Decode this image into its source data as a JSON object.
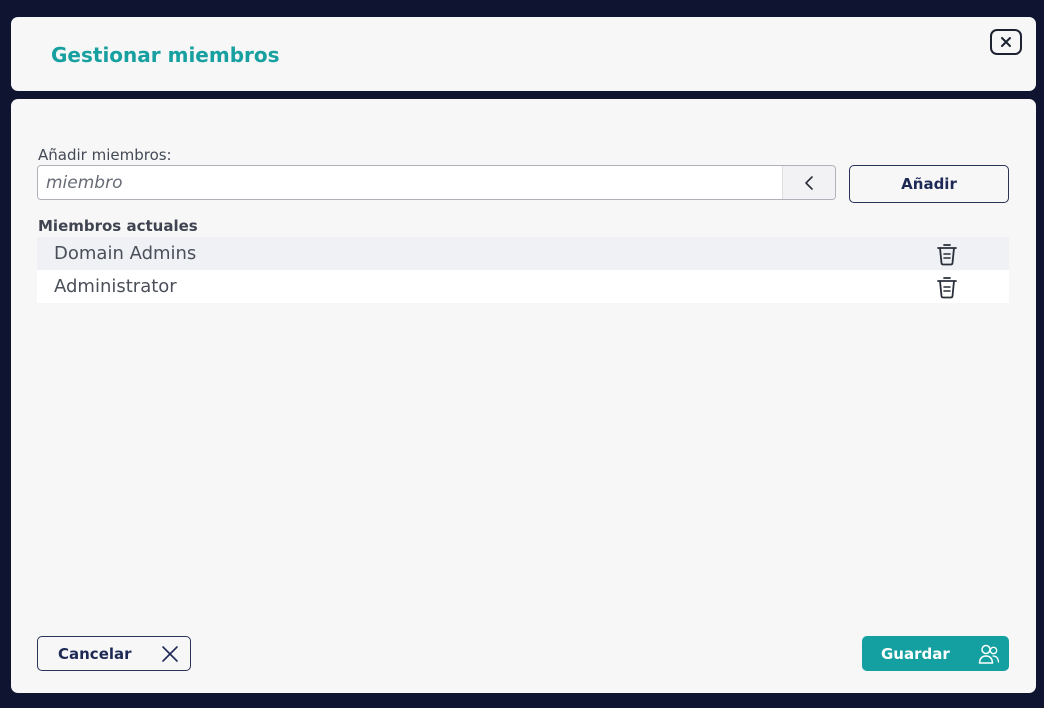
{
  "dialog": {
    "title": "Gestionar miembros",
    "close_icon": "close-icon"
  },
  "add_members": {
    "label": "Añadir miembros:",
    "input_value": "",
    "input_placeholder": "miembro",
    "dropdown_icon": "chevron-left-icon",
    "add_button_label": "Añadir"
  },
  "current_members": {
    "label": "Miembros actuales",
    "items": [
      {
        "name": "Domain Admins",
        "icon": "trash-icon"
      },
      {
        "name": "Administrator",
        "icon": "trash-icon"
      }
    ]
  },
  "footer": {
    "cancel_label": "Cancelar",
    "cancel_icon": "x-icon",
    "save_label": "Guardar",
    "save_icon": "users-icon"
  },
  "colors": {
    "accent": "#14a0a0",
    "title": "#18a0a0",
    "navy": "#1e2a55",
    "background": "#0f1530",
    "panel": "#f7f7f8"
  }
}
